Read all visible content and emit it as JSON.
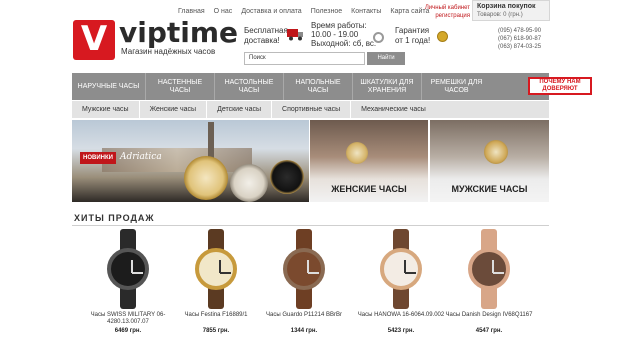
{
  "topnav": [
    "Главная",
    "О нас",
    "Доставка и оплата",
    "Полезное",
    "Контакты",
    "Карта сайта"
  ],
  "account": {
    "line1": "Личный кабинет",
    "line2": "регистрация"
  },
  "cart": {
    "title": "Корзина покупок",
    "count": "Товаров: 0 (грн.)"
  },
  "logo": {
    "letter": "V",
    "text": "viptime",
    "tagline": "Магазин надёжных часов"
  },
  "promo": {
    "delivery": [
      "Бесплатная",
      "доставка!"
    ],
    "hours": [
      "Время работы:",
      "10.00 - 19.00",
      "Выходной: сб, вс."
    ],
    "guarantee": [
      "Гарантия",
      "от 1 года!"
    ]
  },
  "phones": [
    "(095) 478-95-90",
    "(067) 618-90-87",
    "(063) 874-03-25"
  ],
  "search": {
    "placeholder": "Поиск",
    "button": "Найти"
  },
  "categories": [
    {
      "label": "НАРУЧНЫЕ ЧАСЫ"
    },
    {
      "label": "НАСТЕННЫЕ ЧАСЫ"
    },
    {
      "label": "НАСТОЛЬНЫЕ ЧАСЫ"
    },
    {
      "label": "НАПОЛЬНЫЕ ЧАСЫ"
    },
    {
      "label": "ШКАТУЛКИ ДЛЯ ХРАНЕНИЯ"
    },
    {
      "label": "РЕМЕШКИ ДЛЯ ЧАСОВ"
    }
  ],
  "why_button": "ПОЧЕМУ НАМ ДОВЕРЯЮТ",
  "subtabs": [
    "Мужские часы",
    "Женские часы",
    "Детские часы",
    "Спортивные часы",
    "Механические часы"
  ],
  "banners": {
    "main": {
      "badge": "НОВИНКИ",
      "brand": "Adriatica"
    },
    "women": "ЖЕНСКИЕ ЧАСЫ",
    "men": "МУЖСКИЕ ЧАСЫ"
  },
  "hits_title": "ХИТЫ ПРОДАЖ",
  "products": [
    {
      "name": "Часы SWISS MILITARY 06-4280.13.007.07",
      "price": "6469 грн.",
      "strap": "#2a2a2a",
      "face": "#1c1c1c",
      "rim": "#555555"
    },
    {
      "name": "Часы Festina F16889/1",
      "price": "7855 грн.",
      "strap": "#5b3a22",
      "face": "#f1e7c8",
      "rim": "#c79a3c"
    },
    {
      "name": "Часы Guardo P11214 BBrBr",
      "price": "1344 грн.",
      "strap": "#6e3f24",
      "face": "#7b4a2e",
      "rim": "#8a6a52"
    },
    {
      "name": "Часы HANOWA 16-6064.09.002",
      "price": "5423 грн.",
      "strap": "#6e4730",
      "face": "#f3ece4",
      "rim": "#d7a87e"
    },
    {
      "name": "Часы Danish Design IV68Q1167",
      "price": "4547 грн.",
      "strap": "#d8a688",
      "face": "#6b4b3a",
      "rim": "#d8a688"
    }
  ]
}
